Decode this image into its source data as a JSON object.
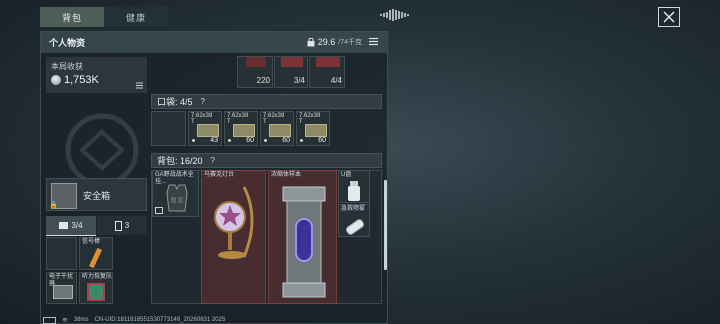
{
  "tabs": [
    "背包",
    "健康"
  ],
  "panel": {
    "title": "个人物资",
    "weight_value": "29.6",
    "weight_total": "/74千克"
  },
  "earnings": {
    "label": "本局收获",
    "value": "1,753K"
  },
  "top_items": [
    {
      "count": "220",
      "icon": "ammo-stack-icon"
    },
    {
      "count": "3/4",
      "icon": "medkit-icon"
    },
    {
      "count": "4/4",
      "icon": "medkit-icon"
    }
  ],
  "pocket": {
    "label": "口袋: 4/5",
    "help": "?",
    "ammo": [
      {
        "caliber": "7.62x39",
        "type": "T",
        "count": "43"
      },
      {
        "caliber": "7.62x39",
        "type": "T",
        "count": "60"
      },
      {
        "caliber": "7.62x39",
        "type": "T",
        "count": "60"
      },
      {
        "caliber": "7.62x39",
        "type": "T",
        "count": "60"
      }
    ]
  },
  "backpack": {
    "label": "背包: 16/20",
    "help": "?",
    "items": [
      {
        "name": "GA野战战术全挂...",
        "icon": "tactical-vest-icon"
      },
      {
        "name": "马赛克灯台",
        "icon": "mosaic-lamp-icon"
      },
      {
        "name": "浓缩体样本",
        "icon": "sample-canister-icon"
      },
      {
        "name": "U盘",
        "icon": "usb-drive-icon"
      },
      {
        "name": "急救喷雾",
        "icon": "spray-icon"
      }
    ]
  },
  "safebox": {
    "label": "安全箱"
  },
  "gear_tabs": [
    {
      "label": "3/4",
      "icon": "medkit-icon"
    },
    {
      "label": "3",
      "icon": "battery-icon"
    }
  ],
  "gear_items": [
    {
      "name": "信号棒",
      "icon": "flare-icon"
    },
    {
      "name": "电子干扰器",
      "icon": "jammer-icon"
    },
    {
      "name": "听力恢复队",
      "icon": "ear-device-icon"
    }
  ],
  "footer": {
    "ping": "38ms",
    "uid": "CN-UID:1811818551530773149_20260831 2025"
  },
  "colors": {
    "accent_red": "#8c3b3b",
    "panel_bg": "#1c252a",
    "tab_active": "#4d5d58"
  }
}
